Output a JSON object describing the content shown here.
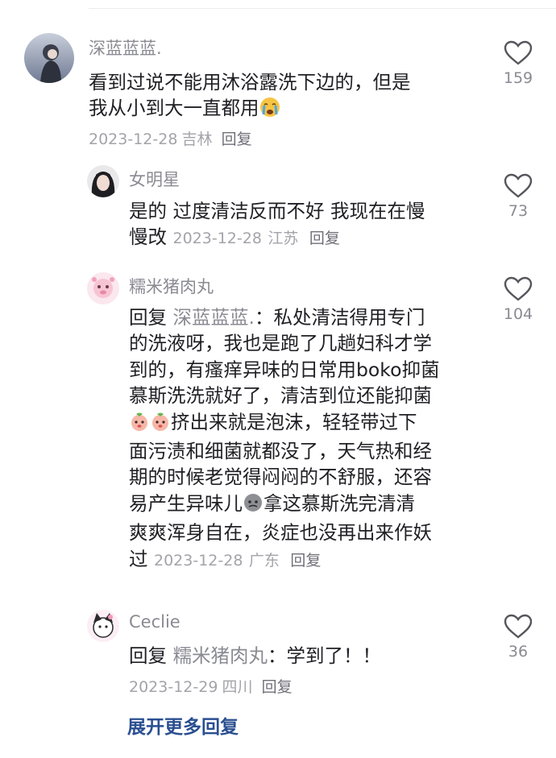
{
  "comments": [
    {
      "username": "深蓝蓝蓝.",
      "lines": [
        "看到过说不能用沐浴露洗下边的，但是",
        "我从小到大一直都用"
      ],
      "emoji": "crying-face",
      "date": "2023-12-28",
      "location": "吉林",
      "reply_label": "回复",
      "likes": "159"
    },
    {
      "username": "女明星",
      "lines": [
        "是的 过度清洁反而不好 我现在在慢",
        "慢改"
      ],
      "date": "2023-12-28",
      "location": "江苏",
      "reply_label": "回复",
      "likes": "73"
    },
    {
      "username": "糯米猪肉丸",
      "reply_prefix": "回复",
      "mention": "深蓝蓝蓝.",
      "colon": "：",
      "first_line_rest": "私处清洁得用专门",
      "lines": [
        "的洗液呀，我也是跑了几趟妇科才学",
        "到的，有瘙痒异味的日常用boko抑菌",
        "慕斯洗洗就好了，清洁到位还能抑菌",
        "挤出来就是泡沫，轻轻带过下",
        "面污渍和细菌就都没了，天气热和经",
        "期的时候老觉得闷闷的不舒服，还容",
        "易产生异味儿",
        "拿这慕斯洗完清清",
        "爽爽浑身自在，炎症也没再出来作妖",
        "过"
      ],
      "date": "2023-12-28",
      "location": "广东",
      "reply_label": "回复",
      "likes": "104"
    },
    {
      "username": "Ceclie",
      "reply_prefix": "回复",
      "mention": "糯米猪肉丸",
      "colon": "：",
      "text": "学到了！！",
      "date": "2023-12-29",
      "location": "四川",
      "reply_label": "回复",
      "likes": "36"
    }
  ],
  "expand_label": "展开更多回复",
  "colors": {
    "link": "#2a4f91",
    "muted": "#8a8a93",
    "text": "#1f1f24"
  }
}
